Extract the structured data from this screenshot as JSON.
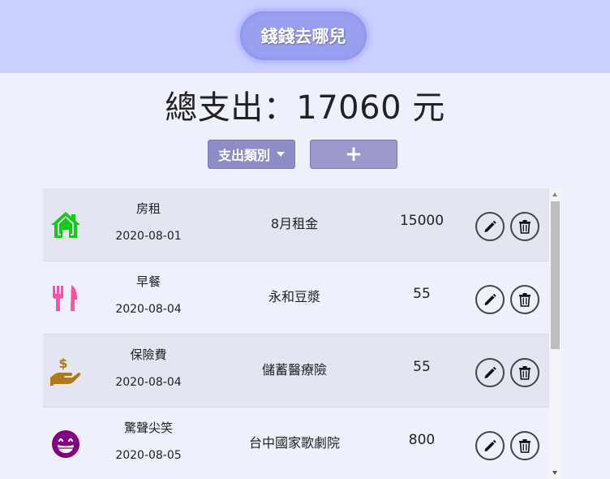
{
  "app": {
    "title": "錢錢去哪兒"
  },
  "summary": {
    "total_label": "總支出：",
    "total_value": "17060",
    "currency": " 元"
  },
  "controls": {
    "category_button": "支出類別",
    "add_button": "+"
  },
  "expenses": [
    {
      "icon": "home-icon",
      "icon_color": "#17c917",
      "name": "房租",
      "date": "2020-08-01",
      "description": "8月租金",
      "amount": "15000"
    },
    {
      "icon": "utensils-icon",
      "icon_color": "#ff4fa6",
      "name": "早餐",
      "date": "2020-08-04",
      "description": "永和豆漿",
      "amount": "55"
    },
    {
      "icon": "hand-money-icon",
      "icon_color": "#b07a16",
      "name": "保險費",
      "date": "2020-08-04",
      "description": "儲蓄醫療險",
      "amount": "55"
    },
    {
      "icon": "grin-face-icon",
      "icon_color": "#800080",
      "name": "驚聲尖笑",
      "date": "2020-08-05",
      "description": "台中國家歌劇院",
      "amount": "800"
    }
  ],
  "colors": {
    "header_bg": "#ccd0ff",
    "page_bg": "#eef0fb",
    "button_bg": "#8f8dc7"
  }
}
